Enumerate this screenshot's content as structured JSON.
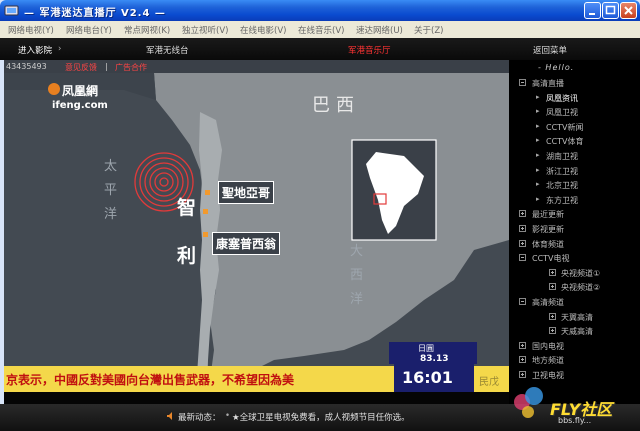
{
  "window": {
    "title": "— 军港迷达直播厅  V2.4  —"
  },
  "menu": [
    "网络电视(Y)",
    "网络电台(Y)",
    "常点网视(K)",
    "独立视听(V)",
    "在线电影(V)",
    "在线音乐(V)",
    "速达网络(U)",
    "关于(Z)"
  ],
  "nav": {
    "enter": "进入影院",
    "radio": "军港无线台",
    "current": "军港音乐厅",
    "back": "返回菜单"
  },
  "video": {
    "counter": "43435493",
    "feedback": "意见反馈",
    "ad": "广告合作",
    "logo_name": "凤凰網",
    "logo_url": "ifeng.com",
    "map_labels": {
      "brazil": "巴西",
      "pacific": [
        "太",
        "平",
        "洋"
      ],
      "atlantic": [
        "大",
        "西",
        "洋"
      ],
      "chile": [
        "智",
        "利"
      ],
      "santiago": "聖地亞哥",
      "concepcion": "康塞普西翁"
    },
    "ticker": "京表示，中國反對美國向台灣出售武器，不希望因為美",
    "ticker_tail": "民戊",
    "market_label": "日圓",
    "market_value": "83.13",
    "clock": "16:01"
  },
  "sidebar": {
    "hello": "- Hello.",
    "items": [
      {
        "label": "高清直播",
        "kind": "group",
        "expanded": true
      },
      {
        "label": "凤凰资讯",
        "kind": "child",
        "selected": true
      },
      {
        "label": "凤凰卫视",
        "kind": "child"
      },
      {
        "label": "CCTV新闻",
        "kind": "child"
      },
      {
        "label": "CCTV体育",
        "kind": "child"
      },
      {
        "label": "湖南卫视",
        "kind": "child"
      },
      {
        "label": "浙江卫视",
        "kind": "child"
      },
      {
        "label": "北京卫视",
        "kind": "child"
      },
      {
        "label": "东方卫视",
        "kind": "child"
      },
      {
        "label": "最近更新",
        "kind": "group",
        "expanded": false
      },
      {
        "label": "影视更新",
        "kind": "group",
        "expanded": false
      },
      {
        "label": "体育频道",
        "kind": "group",
        "expanded": false
      },
      {
        "label": "CCTV电视",
        "kind": "group",
        "expanded": true
      },
      {
        "label": "央视频道①",
        "kind": "subgroup"
      },
      {
        "label": "央视频道②",
        "kind": "subgroup"
      },
      {
        "label": "高清频道",
        "kind": "group",
        "expanded": true
      },
      {
        "label": "天翼高清",
        "kind": "subgroup"
      },
      {
        "label": "天威高清",
        "kind": "subgroup"
      },
      {
        "label": "国内电视",
        "kind": "group",
        "expanded": false
      },
      {
        "label": "地方频道",
        "kind": "group",
        "expanded": false
      },
      {
        "label": "卫视电视",
        "kind": "group",
        "expanded": false
      }
    ]
  },
  "status": {
    "prefix": "最新动态：",
    "message": "★全球卫星电视免费看，成人视频节目任你选。"
  },
  "watermark": {
    "brand": "FLY社区",
    "url": "bbs.fly..."
  },
  "colors": {
    "title_bar": "#1e62d8",
    "accent_red": "#ff3333",
    "ticker_bg": "#f4d84a"
  }
}
